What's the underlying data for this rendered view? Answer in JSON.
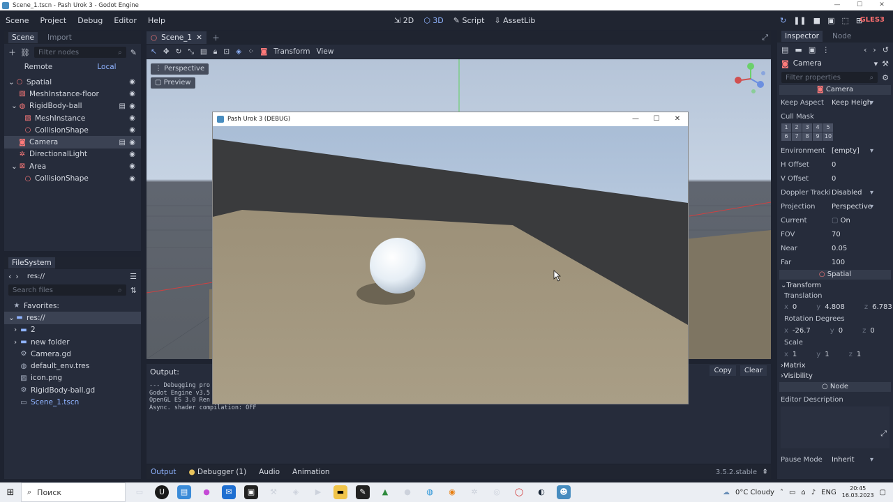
{
  "window": {
    "title": "Scene_1.tscn - Pash Urok 3 - Godot Engine"
  },
  "menu": [
    "Scene",
    "Project",
    "Debug",
    "Editor",
    "Help"
  ],
  "workspaces": [
    {
      "label": "2D",
      "icon": "2d-icon"
    },
    {
      "label": "3D",
      "icon": "3d-icon"
    },
    {
      "label": "Script",
      "icon": "script-icon"
    },
    {
      "label": "AssetLib",
      "icon": "assetlib-icon"
    }
  ],
  "renderer": "GLES3",
  "scene_dock": {
    "tabs": [
      "Scene",
      "Import"
    ],
    "filter_placeholder": "Filter nodes",
    "remote_label": "Remote",
    "local_label": "Local",
    "nodes": [
      {
        "label": "Spatial",
        "indent": 0
      },
      {
        "label": "MeshInstance-floor",
        "indent": 1
      },
      {
        "label": "RigidBody-ball",
        "indent": 1
      },
      {
        "label": "MeshInstance",
        "indent": 2
      },
      {
        "label": "CollisionShape",
        "indent": 2
      },
      {
        "label": "Camera",
        "indent": 1
      },
      {
        "label": "DirectionalLight",
        "indent": 1
      },
      {
        "label": "Area",
        "indent": 1
      },
      {
        "label": "CollisionShape",
        "indent": 2
      }
    ]
  },
  "filesystem": {
    "title": "FileSystem",
    "path": "res://",
    "search_placeholder": "Search files",
    "items": [
      {
        "label": "Favorites:",
        "indent": 0
      },
      {
        "label": "res://",
        "indent": 0
      },
      {
        "label": "2",
        "indent": 1
      },
      {
        "label": "new folder",
        "indent": 1
      },
      {
        "label": "Camera.gd",
        "indent": 1
      },
      {
        "label": "default_env.tres",
        "indent": 1
      },
      {
        "label": "icon.png",
        "indent": 1
      },
      {
        "label": "RigidBody-ball.gd",
        "indent": 1
      },
      {
        "label": "Scene_1.tscn",
        "indent": 1
      }
    ]
  },
  "editor_tab": "Scene_1",
  "viewport_toolbar": {
    "transform": "Transform",
    "view": "View"
  },
  "viewport": {
    "perspective": "Perspective",
    "preview": "Preview"
  },
  "debug_window": {
    "title": "Pash Urok 3 (DEBUG)"
  },
  "output": {
    "title": "Output:",
    "copy": "Copy",
    "clear": "Clear",
    "lines": [
      "--- Debugging pro",
      "Godot Engine v3.5",
      "OpenGL ES 3.0 Ren",
      "Async. shader compilation: OFF"
    ]
  },
  "bottom_tabs": [
    "Output",
    "Debugger (1)",
    "Audio",
    "Animation"
  ],
  "version": "3.5.2.stable",
  "inspector": {
    "tabs": [
      "Inspector",
      "Node"
    ],
    "object": "Camera",
    "filter_placeholder": "Filter properties",
    "section_camera": "Camera",
    "keep_aspect_label": "Keep Aspect",
    "keep_aspect_value": "Keep Heigh",
    "cull_mask_label": "Cull Mask",
    "cull_mask": [
      "1",
      "2",
      "3",
      "4",
      "5",
      "6",
      "7",
      "8",
      "9",
      "10"
    ],
    "environment_label": "Environment",
    "environment_value": "[empty]",
    "h_offset_label": "H Offset",
    "h_offset_value": "0",
    "v_offset_label": "V Offset",
    "v_offset_value": "0",
    "doppler_label": "Doppler Tracki",
    "doppler_value": "Disabled",
    "projection_label": "Projection",
    "projection_value": "Perspective",
    "current_label": "Current",
    "current_value": "On",
    "fov_label": "FOV",
    "fov_value": "70",
    "near_label": "Near",
    "near_value": "0.05",
    "far_label": "Far",
    "far_value": "100",
    "section_spatial": "Spatial",
    "transform_label": "Transform",
    "translation_label": "Translation",
    "translation": {
      "x": "0",
      "y": "4.808",
      "z": "6.783"
    },
    "rotation_label": "Rotation Degrees",
    "rotation": {
      "x": "-26.7",
      "y": "0",
      "z": "0"
    },
    "scale_label": "Scale",
    "scale": {
      "x": "1",
      "y": "1",
      "z": "1"
    },
    "matrix_label": "Matrix",
    "visibility_label": "Visibility",
    "section_node": "Node",
    "editor_description_label": "Editor Description",
    "pause_mode_label": "Pause Mode",
    "pause_mode_value": "Inherit"
  },
  "taskbar": {
    "search_label": "Поиск",
    "weather": "0°C  Cloudy",
    "lang": "ENG",
    "time": "20:45",
    "date": "16.03.2023"
  }
}
